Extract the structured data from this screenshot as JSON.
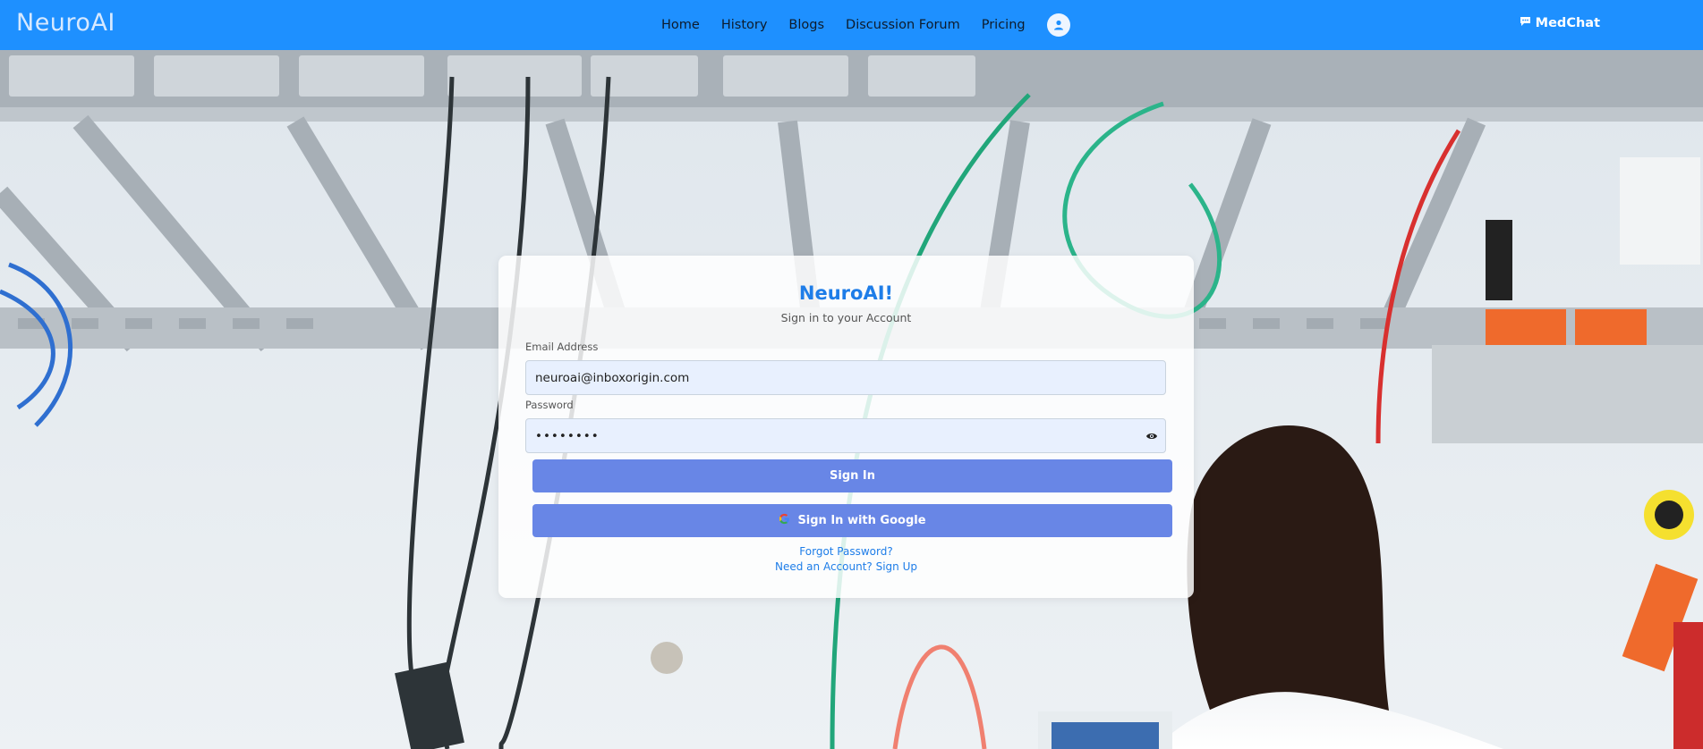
{
  "nav": {
    "brand": "NeuroAI",
    "links": [
      "Home",
      "History",
      "Blogs",
      "Discussion Forum",
      "Pricing"
    ],
    "profile_icon": "user-circle-icon",
    "medchat_label": "MedChat",
    "medchat_icon": "chat-bubble-icon"
  },
  "login": {
    "title": "NeuroAI!",
    "subtitle": "Sign in to your Account",
    "email_label": "Email Address",
    "email_value": "neuroai@inboxorigin.com",
    "password_label": "Password",
    "password_value": "••••••••",
    "password_toggle_icon": "eye-icon",
    "sign_in_label": "Sign In",
    "google_label": "Sign In with Google",
    "google_icon": "google-g-icon",
    "forgot_label": "Forgot Password?",
    "signup_label": "Need an Account? Sign Up"
  },
  "colors": {
    "navbar": "#1e90ff",
    "accent": "#1e7de8",
    "button": "#6886e6"
  }
}
